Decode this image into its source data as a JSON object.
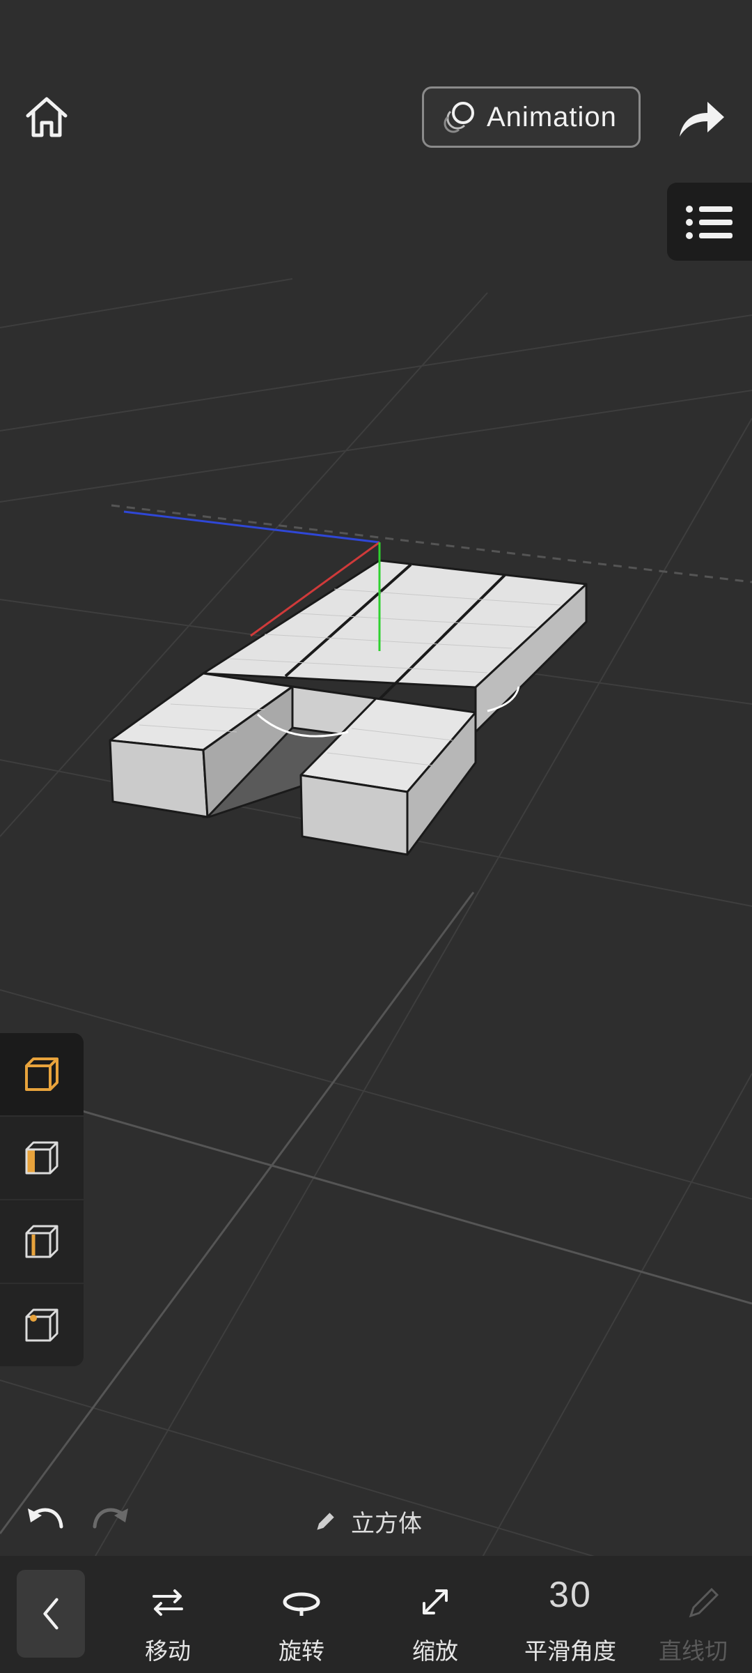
{
  "header": {
    "animation_label": "Animation"
  },
  "selection_modes": [
    {
      "name": "object",
      "active": true
    },
    {
      "name": "face",
      "active": false
    },
    {
      "name": "edge",
      "active": false
    },
    {
      "name": "vertex",
      "active": false
    }
  ],
  "object": {
    "name": "立方体"
  },
  "toolbar": {
    "move_label": "移动",
    "rotate_label": "旋转",
    "scale_label": "缩放",
    "smooth_angle_value": "30",
    "smooth_angle_label": "平滑角度",
    "line_cut_label": "直线切"
  },
  "colors": {
    "background": "#2e2e2e",
    "accent": "#e8a33c",
    "axis_x": "#d03a3a",
    "axis_y": "#2fd12f",
    "axis_z": "#2f47d6"
  }
}
